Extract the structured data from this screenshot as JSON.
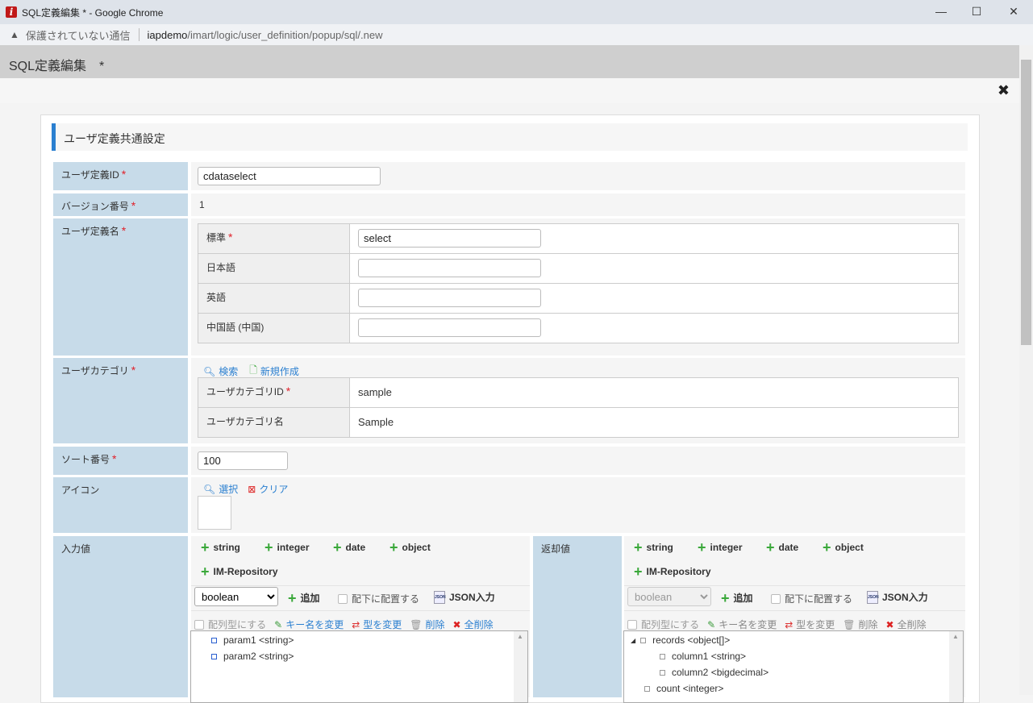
{
  "window": {
    "title": "SQL定義編集 * - Google Chrome",
    "minimize": "—",
    "maximize": "☐",
    "close": "✕"
  },
  "address": {
    "insecure": "保護されていない通信",
    "host": "iapdemo",
    "path": "/imart/logic/user_definition/popup/sql/.new"
  },
  "app": {
    "title": "SQL定義編集　*",
    "close": "✖"
  },
  "section": {
    "title": "ユーザ定義共通設定"
  },
  "form": {
    "id_label": "ユーザ定義ID",
    "id_value": "cdataselect",
    "version_label": "バージョン番号",
    "version_value": "1",
    "name_label": "ユーザ定義名",
    "names": [
      {
        "label": "標準",
        "value": "select",
        "required": true
      },
      {
        "label": "日本語",
        "value": ""
      },
      {
        "label": "英語",
        "value": ""
      },
      {
        "label": "中国語 (中国)",
        "value": ""
      }
    ],
    "category_label": "ユーザカテゴリ",
    "search": "検索",
    "create": "新規作成",
    "category_id_label": "ユーザカテゴリID",
    "category_id": "sample",
    "category_name_label": "ユーザカテゴリ名",
    "category_name": "Sample",
    "sort_label": "ソート番号",
    "sort_value": "100",
    "icon_label": "アイコン",
    "select": "選択",
    "clear": "クリア",
    "input_label": "入力値",
    "output_label": "返却値"
  },
  "types": [
    "string",
    "integer",
    "date",
    "object",
    "IM-Repository"
  ],
  "toolbar": {
    "select_value": "boolean",
    "add": "追加",
    "place_under": "配下に配置する",
    "json": "JSON入力",
    "array": "配列型にする",
    "rename": "キー名を変更",
    "retype": "型を変更",
    "delete": "削除",
    "delete_all": "全削除"
  },
  "input_tree": [
    {
      "label": "param1 <string>"
    },
    {
      "label": "param2 <string>"
    }
  ],
  "output_tree": [
    {
      "label": "records <object[]>"
    },
    {
      "label": "column1 <string>"
    },
    {
      "label": "column2 <bigdecimal>"
    },
    {
      "label": "count <integer>"
    }
  ]
}
